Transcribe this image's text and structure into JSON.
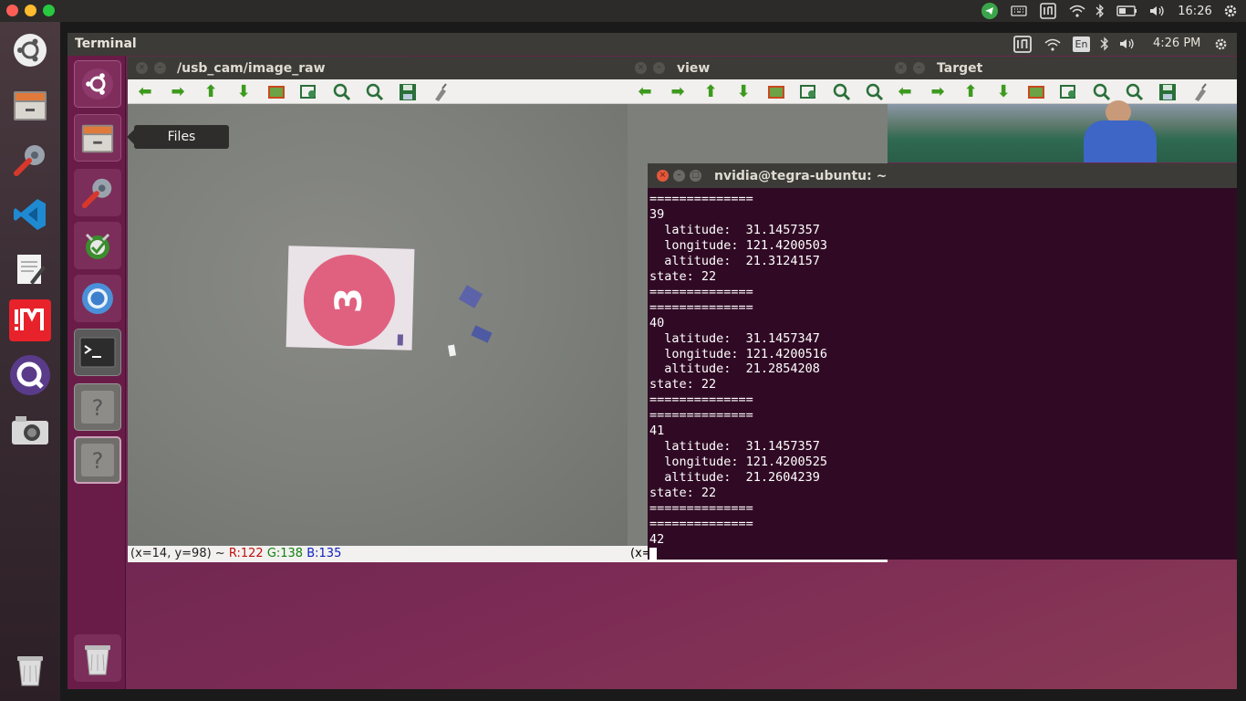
{
  "host": {
    "clock": "16:26"
  },
  "vm": {
    "app_title": "Terminal",
    "lang": "En",
    "clock": "4:26 PM"
  },
  "launcher_tooltip": "Files",
  "image_windows": [
    {
      "title": "/usb_cam/image_raw"
    },
    {
      "title": "view"
    },
    {
      "title": "Target"
    }
  ],
  "status_bar": {
    "coords": "(x=14, y=98) ~",
    "r": "R:122",
    "g": "G:138",
    "b": "B:135",
    "view_coords": "(x="
  },
  "landing_pad": {
    "number": "3"
  },
  "terminal": {
    "title": "nvidia@tegra-ubuntu: ~",
    "lines": [
      "==============",
      "39",
      "  latitude:  31.1457357",
      "  longitude: 121.4200503",
      "  altitude:  21.3124157",
      "state: 22",
      "==============",
      "==============",
      "40",
      "  latitude:  31.1457347",
      "  longitude: 121.4200516",
      "  altitude:  21.2854208",
      "state: 22",
      "==============",
      "==============",
      "41",
      "  latitude:  31.1457357",
      "  longitude: 121.4200525",
      "  altitude:  21.2604239",
      "state: 22",
      "==============",
      "==============",
      "42"
    ]
  }
}
